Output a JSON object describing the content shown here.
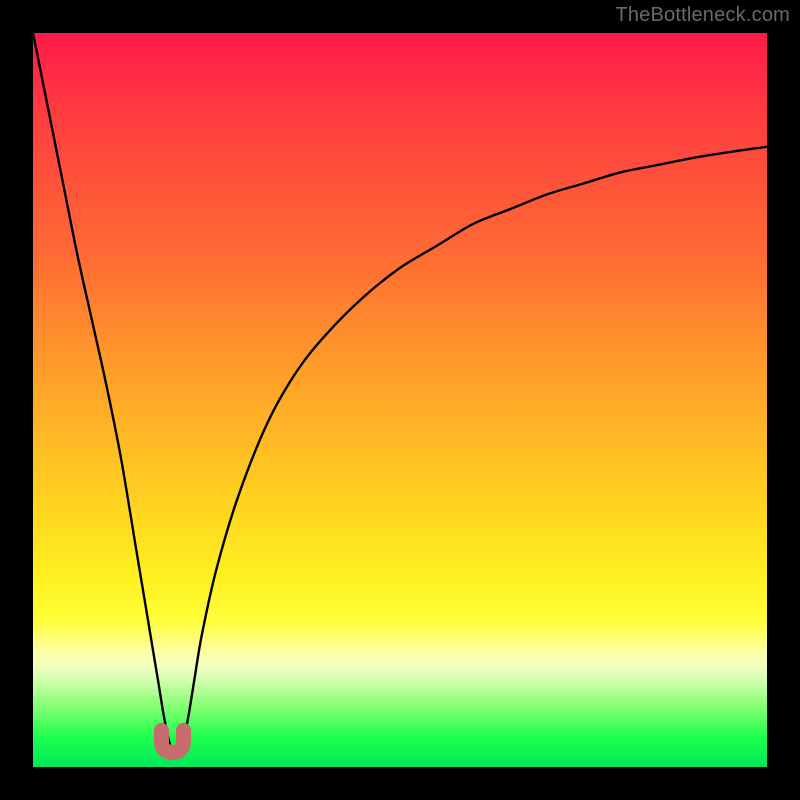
{
  "watermark": "TheBottleneck.com",
  "colors": {
    "frame": "#000000",
    "gradient_top": "#ff1a49",
    "gradient_mid": "#ffd021",
    "gradient_bottom": "#00e85a",
    "curve": "#000000",
    "marker": "#c76b6b"
  },
  "chart_data": {
    "type": "line",
    "title": "",
    "xlabel": "",
    "ylabel": "",
    "xlim": [
      0,
      100
    ],
    "ylim": [
      0,
      100
    ],
    "note": "Axes unlabeled; x and y normalized 0–100 from plot area. y is percent-like (0 bottom, 100 top). Curve is a sharp V dipping to ~0 near x≈19 with a steep left branch and a slower-rising right branch.",
    "series": [
      {
        "name": "bottleneck-curve",
        "x": [
          0,
          2,
          4,
          6,
          8,
          10,
          12,
          14,
          15,
          16,
          17,
          18,
          19,
          20,
          21,
          22,
          23,
          25,
          28,
          32,
          36,
          40,
          45,
          50,
          55,
          60,
          65,
          70,
          75,
          80,
          85,
          90,
          95,
          100
        ],
        "y": [
          100,
          90,
          80,
          70,
          61,
          52,
          42,
          30,
          24,
          18,
          12,
          6,
          2,
          2,
          6,
          12,
          18,
          27,
          37,
          47,
          54,
          59,
          64,
          68,
          71,
          74,
          76,
          78,
          79.5,
          81,
          82,
          83,
          83.8,
          84.5
        ]
      }
    ],
    "markers": [
      {
        "name": "dip-u-marker",
        "shape": "U",
        "x_center": 19,
        "y_bottom": 2,
        "width_x": 3,
        "color": "#c76b6b"
      }
    ]
  }
}
